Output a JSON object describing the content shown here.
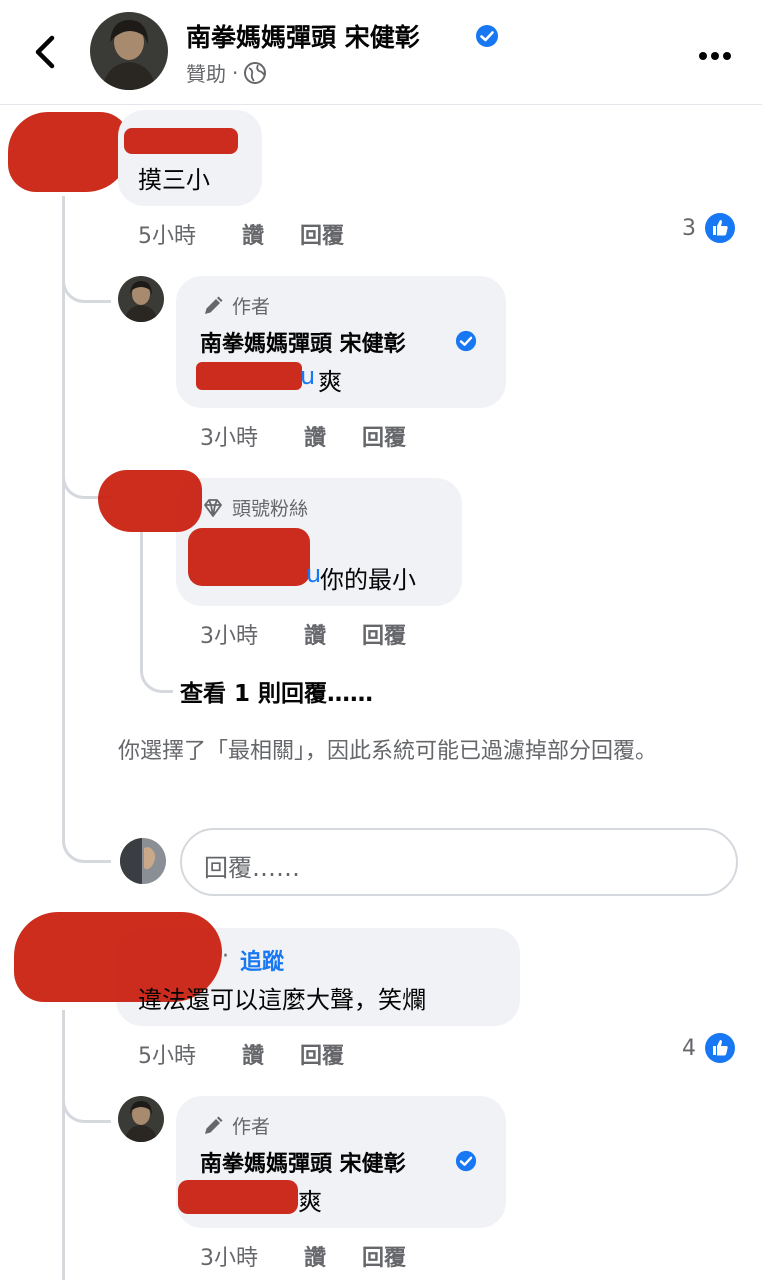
{
  "header": {
    "page_name": "南拳媽媽彈頭  宋健彰",
    "sponsored_label": "贊助",
    "sponsored_dot": "·"
  },
  "threads": [
    {
      "comment": {
        "text": "摸三小",
        "time": "5小時",
        "like_label": "讚",
        "reply_label": "回覆",
        "like_count": "3"
      },
      "replies": [
        {
          "badge": "作者",
          "name": "南拳媽媽彈頭  宋健彰",
          "mention_tail": "u",
          "text": "爽",
          "time": "3小時",
          "like_label": "讚",
          "reply_label": "回覆"
        },
        {
          "badge": "頭號粉絲",
          "mention_tail": "u",
          "text": "你的最小",
          "time": "3小時",
          "like_label": "讚",
          "reply_label": "回覆"
        }
      ],
      "view_more": "查看 1 則回覆……",
      "filter_note": "你選擇了「最相關」，因此系統可能已過濾掉部分回覆。",
      "reply_placeholder": "回覆……"
    },
    {
      "comment": {
        "follow_label": "追蹤",
        "dot": "·",
        "text": "違法還可以這麼大聲，笑爛",
        "time": "5小時",
        "like_label": "讚",
        "reply_label": "回覆",
        "like_count": "4"
      },
      "replies": [
        {
          "badge": "作者",
          "name": "南拳媽媽彈頭  宋健彰",
          "text": "爽",
          "time": "3小時",
          "like_label": "讚",
          "reply_label": "回覆"
        }
      ]
    }
  ],
  "colors": {
    "accent": "#1877f2",
    "bubble": "#f0f2f5",
    "meta": "#65676b",
    "redaction": "#c81b0a"
  },
  "icons": [
    "back-chevron-icon",
    "verified-badge-icon",
    "globe-icon",
    "more-dots-icon",
    "like-thumb-icon",
    "pencil-icon",
    "diamond-icon"
  ]
}
